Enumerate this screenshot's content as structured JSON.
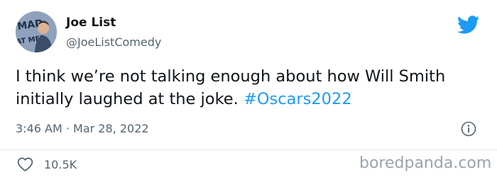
{
  "author": {
    "display_name": "Joe List",
    "handle": "@JoeListComedy",
    "avatar_sign_text": "MAD AT ME?"
  },
  "tweet": {
    "text": "I think we’re not talking enough about how Will Smith initially laughed at the joke. ",
    "hashtag": "#Oscars2022",
    "timestamp": "3:46 AM · Mar 28, 2022"
  },
  "actions": {
    "like_count": "10.5K"
  },
  "watermark": "boredpanda.com",
  "icons": {
    "logo": "twitter-bird-icon",
    "info": "info-icon",
    "like": "heart-icon"
  },
  "colors": {
    "brand_blue": "#1d9bf0",
    "text_primary": "#0f1419",
    "text_secondary": "#536471",
    "divider": "#e7e9ea"
  }
}
